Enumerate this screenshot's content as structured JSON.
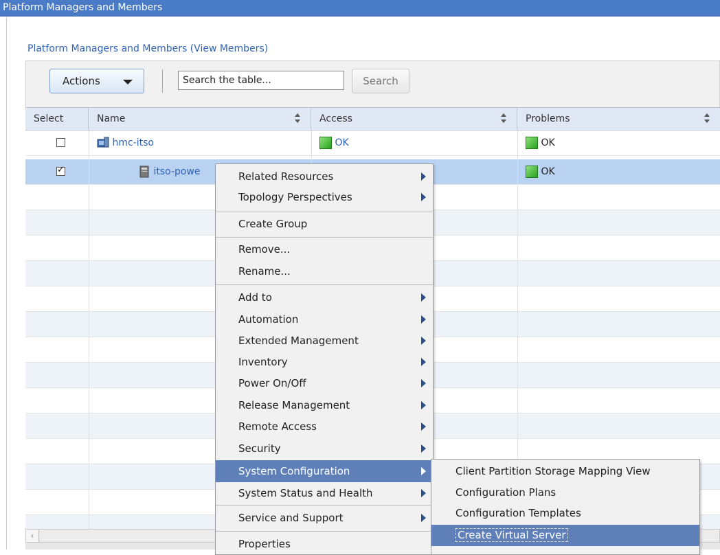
{
  "window": {
    "title": "Platform Managers and Members"
  },
  "panel": {
    "title": "Platform Managers and Members (View Members)"
  },
  "toolbar": {
    "actions_label": "Actions",
    "search_value": "Search the table...",
    "search_button": "Search"
  },
  "table": {
    "columns": [
      "Select",
      "Name",
      "Access",
      "Problems"
    ],
    "rows": [
      {
        "selected": false,
        "name": "hmc-itso",
        "access": "OK",
        "problems": "OK"
      },
      {
        "selected": true,
        "name": "itso-powe",
        "access": "",
        "problems": "OK"
      }
    ]
  },
  "context_menu": {
    "items": [
      {
        "label": "Related Resources",
        "submenu": true
      },
      {
        "label": "Topology Perspectives",
        "submenu": true
      },
      {
        "label": "Create Group",
        "submenu": false
      },
      {
        "label": "Remove...",
        "submenu": false
      },
      {
        "label": "Rename...",
        "submenu": false
      },
      {
        "label": "Add to",
        "submenu": true
      },
      {
        "label": "Automation",
        "submenu": true
      },
      {
        "label": "Extended Management",
        "submenu": true
      },
      {
        "label": "Inventory",
        "submenu": true
      },
      {
        "label": "Power On/Off",
        "submenu": true
      },
      {
        "label": "Release Management",
        "submenu": true
      },
      {
        "label": "Remote Access",
        "submenu": true
      },
      {
        "label": "Security",
        "submenu": true
      },
      {
        "label": "System Configuration",
        "submenu": true,
        "highlighted": true
      },
      {
        "label": "System Status and Health",
        "submenu": true
      },
      {
        "label": "Service and Support",
        "submenu": true
      },
      {
        "label": "Properties",
        "submenu": false
      }
    ]
  },
  "submenu": {
    "items": [
      {
        "label": "Client Partition Storage Mapping View"
      },
      {
        "label": "Configuration Plans"
      },
      {
        "label": "Configuration Templates"
      },
      {
        "label": "Create Virtual Server",
        "highlighted": true
      }
    ]
  },
  "colors": {
    "title_bar": "#4a7bc7",
    "menu_highlight": "#5e7fb7",
    "link": "#2f63b5",
    "selected_row": "#b9d2f2"
  }
}
